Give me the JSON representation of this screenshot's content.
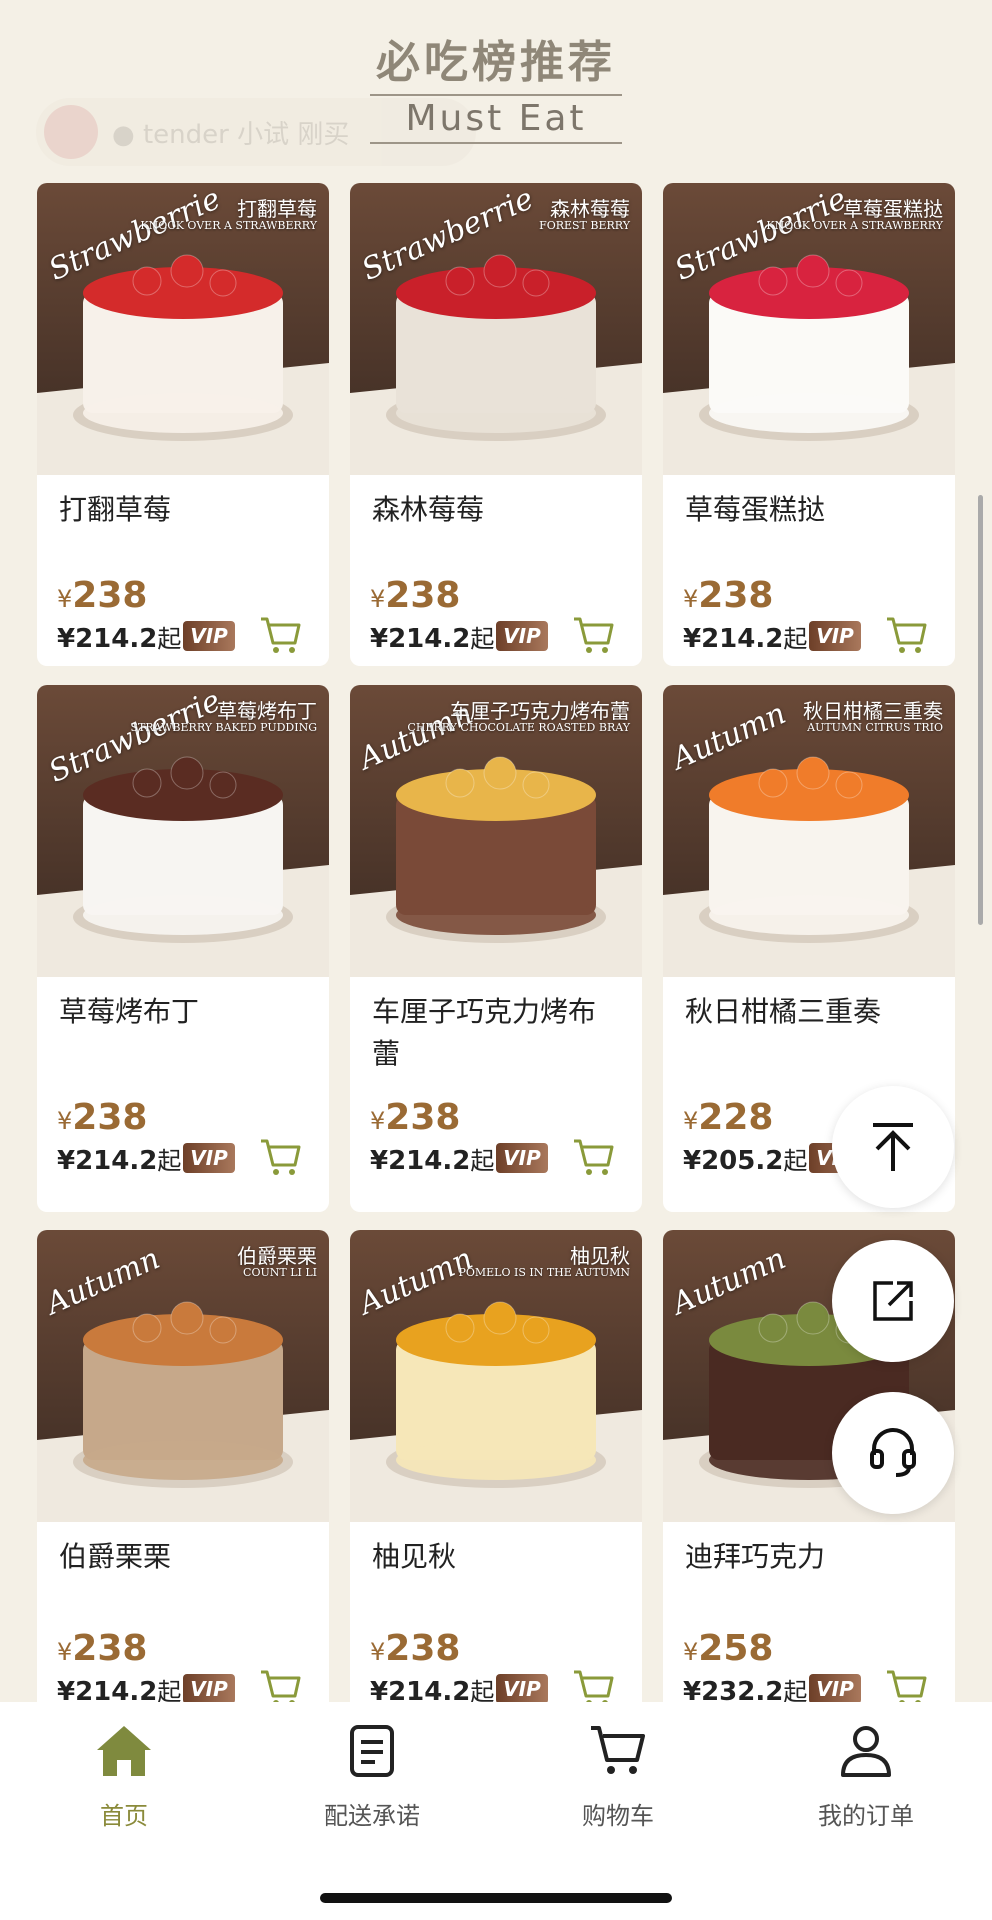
{
  "header": {
    "title_cn": "必吃榜推荐",
    "title_en": "Must Eat",
    "ticker_text": "● tender 小试 刚买"
  },
  "products": [
    {
      "name": "打翻草莓",
      "price": "238",
      "vip_price": "¥214.2",
      "vip_suffix": "起",
      "season": "Strawberrie",
      "label_cn": "打翻草莓",
      "label_en": "KNOCK OVER A STRAWBERRY",
      "cake_top": "#d42b2b",
      "cake_body": "#f7f1ea"
    },
    {
      "name": "森林莓莓",
      "price": "238",
      "vip_price": "¥214.2",
      "vip_suffix": "起",
      "season": "Strawberrie",
      "label_cn": "森林莓莓",
      "label_en": "FOREST BERRY",
      "cake_top": "#c9202a",
      "cake_body": "#e9e2d8"
    },
    {
      "name": "草莓蛋糕挞",
      "price": "238",
      "vip_price": "¥214.2",
      "vip_suffix": "起",
      "season": "Strawberrie",
      "label_cn": "草莓蛋糕挞",
      "label_en": "KNOCK OVER A STRAWBERRY",
      "cake_top": "#d8233f",
      "cake_body": "#fbfaf7"
    },
    {
      "name": "草莓烤布丁",
      "price": "238",
      "vip_price": "¥214.2",
      "vip_suffix": "起",
      "season": "Strawberrie",
      "label_cn": "草莓烤布丁",
      "label_en": "STRAWBERRY BAKED PUDDING",
      "cake_top": "#5a2c22",
      "cake_body": "#f7f5f2"
    },
    {
      "name": "车厘子巧克力烤布蕾",
      "price": "238",
      "vip_price": "¥214.2",
      "vip_suffix": "起",
      "season": "Autumn",
      "label_cn": "车厘子巧克力烤布蕾",
      "label_en": "CHERRY CHOCOLATE ROASTED BRAY",
      "cake_top": "#e8b54a",
      "cake_body": "#7a4a38"
    },
    {
      "name": "秋日柑橘三重奏",
      "price": "228",
      "vip_price": "¥205.2",
      "vip_suffix": "起",
      "season": "Autumn",
      "label_cn": "秋日柑橘三重奏",
      "label_en": "AUTUMN CITRUS TRIO",
      "cake_top": "#f07c2a",
      "cake_body": "#f8f4ee"
    },
    {
      "name": "伯爵栗栗",
      "price": "238",
      "vip_price": "¥214.2",
      "vip_suffix": "起",
      "season": "Autumn",
      "label_cn": "伯爵栗栗",
      "label_en": "COUNT LI LI",
      "cake_top": "#c97a3c",
      "cake_body": "#c6a88a"
    },
    {
      "name": "柚见秋",
      "price": "238",
      "vip_price": "¥214.2",
      "vip_suffix": "起",
      "season": "Autumn",
      "label_cn": "柚见秋",
      "label_en": "POMELO IS IN THE AUTUMN",
      "cake_top": "#e8a21f",
      "cake_body": "#f6e7b8"
    },
    {
      "name": "迪拜巧克力",
      "price": "258",
      "vip_price": "¥232.2",
      "vip_suffix": "起",
      "season": "Autumn",
      "label_cn": "",
      "label_en": "",
      "cake_top": "#7a8a3e",
      "cake_body": "#4a2a22"
    }
  ],
  "currency": "¥",
  "vip_label": "VIP",
  "floating": {
    "top_icon": "arrow-to-top-icon",
    "share_icon": "share-icon",
    "service_icon": "headset-icon"
  },
  "tabs": [
    {
      "label": "首页",
      "icon": "home-icon",
      "active": true
    },
    {
      "label": "配送承诺",
      "icon": "document-icon",
      "active": false
    },
    {
      "label": "购物车",
      "icon": "cart-icon",
      "active": false
    },
    {
      "label": "我的订单",
      "icon": "person-icon",
      "active": false
    }
  ],
  "colors": {
    "background": "#f4f0e6",
    "price": "#9a6a34",
    "active_tab": "#8a8a3a",
    "cart": "#8a9a3a"
  }
}
